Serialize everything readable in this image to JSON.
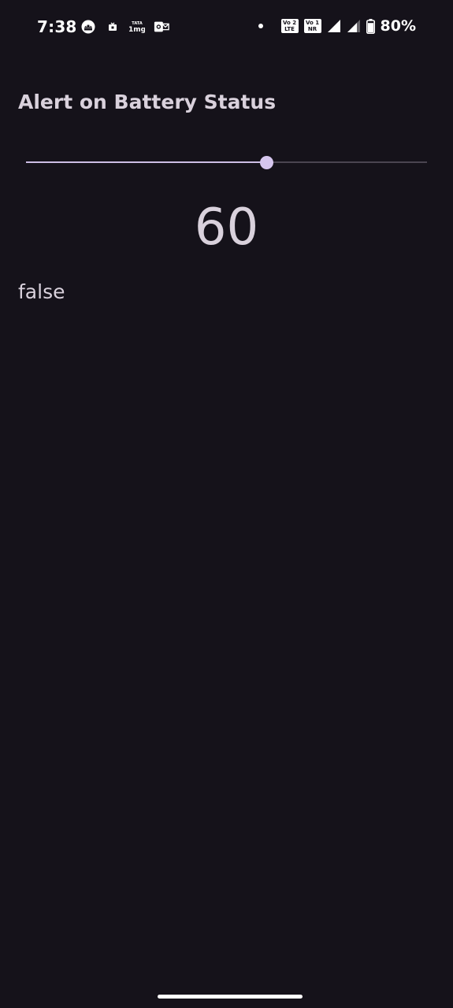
{
  "status_bar": {
    "time": "7:38",
    "notification_icons": [
      "android-app-icon",
      "media-icon",
      "tata-1mg-icon",
      "outlook-icon"
    ],
    "vo_lte_top": "Vo 2",
    "vo_lte_bottom": "LTE",
    "vo_nr_top": "Vo 1",
    "vo_nr_bottom": "NR",
    "battery_percent": "80%",
    "battery_level": 0.8
  },
  "screen": {
    "title": "Alert on Battery Status",
    "slider": {
      "value": 60,
      "min": 0,
      "max": 100,
      "active_color": "#cdbde4",
      "inactive_color": "#4a4550"
    },
    "value_display": "60",
    "status_text": "false"
  },
  "colors": {
    "background": "#15121a",
    "text": "#d9d1dc"
  }
}
